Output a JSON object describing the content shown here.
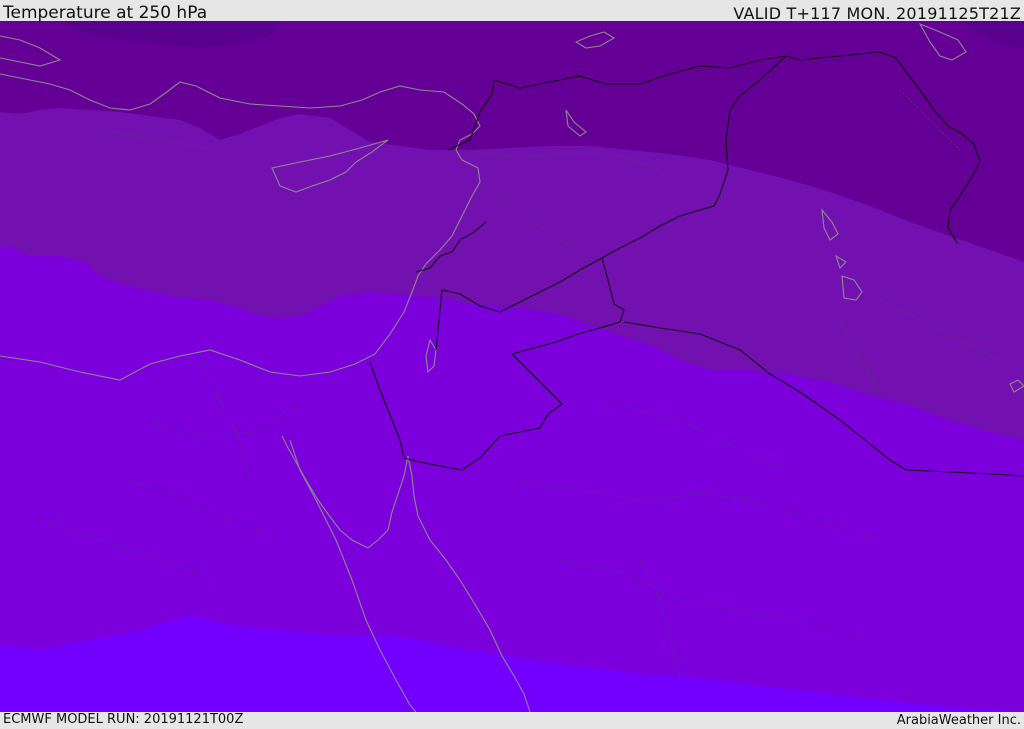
{
  "header": {
    "title": "Temperature at 250 hPa",
    "valid": "VALID T+117 MON. 20191125T21Z"
  },
  "footer": {
    "model_run": "ECMWF MODEL RUN: 20191121T00Z",
    "brand": "ArabiaWeather Inc."
  },
  "map": {
    "region": "Eastern Mediterranean and Middle East",
    "bands": [
      {
        "name": "coldest-band",
        "color": "#5b008e"
      },
      {
        "name": "very-cold-band",
        "color": "#650096"
      },
      {
        "name": "cold-band",
        "color": "#7311b0"
      },
      {
        "name": "cool-band",
        "color": "#7b00db"
      },
      {
        "name": "warm-band",
        "color": "#7300ff"
      }
    ],
    "coastline_color": "#8a8a8a",
    "border_color": "#111111"
  }
}
